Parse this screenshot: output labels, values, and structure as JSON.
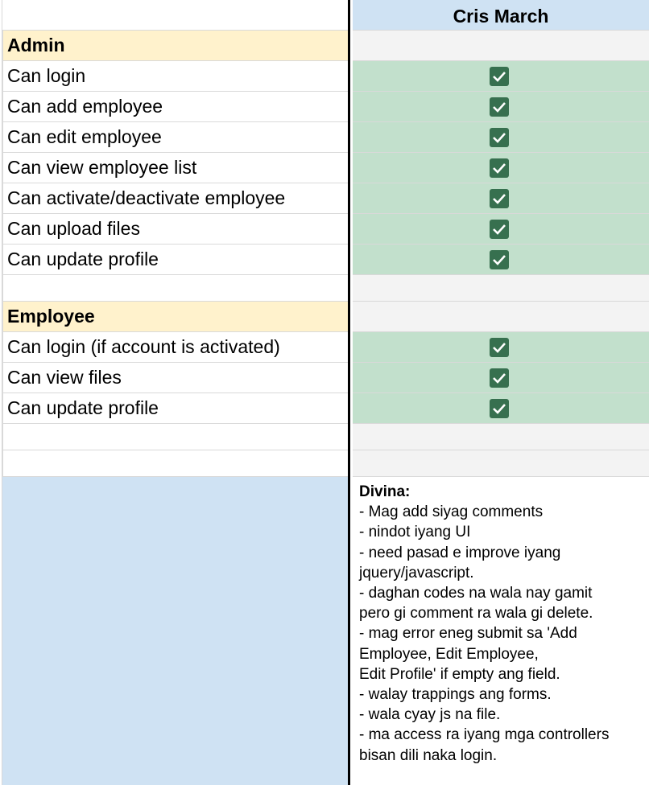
{
  "header": {
    "column_name": "Cris March"
  },
  "sections": [
    {
      "title": "Admin",
      "items": [
        {
          "label": "Can login",
          "checked": true
        },
        {
          "label": "Can add employee",
          "checked": true
        },
        {
          "label": "Can edit employee",
          "checked": true
        },
        {
          "label": "Can view employee list",
          "checked": true
        },
        {
          "label": "Can activate/deactivate employee",
          "checked": true
        },
        {
          "label": "Can upload files",
          "checked": true
        },
        {
          "label": "Can update profile",
          "checked": true
        }
      ]
    },
    {
      "title": "Employee",
      "items": [
        {
          "label": "Can login (if account is activated)",
          "checked": true
        },
        {
          "label": "Can view files",
          "checked": true
        },
        {
          "label": "Can update profile",
          "checked": true
        }
      ]
    }
  ],
  "notes": {
    "author": "Divina:",
    "lines": [
      "- Mag add siyag comments",
      "- nindot iyang UI",
      "- need pasad e improve iyang",
      "jquery/javascript.",
      "- daghan codes na wala nay gamit",
      "pero gi comment ra wala gi delete.",
      "- mag error eneg submit sa 'Add",
      "Employee, Edit Employee,",
      "Edit Profile' if empty ang field.",
      "- walay trappings ang forms.",
      "- wala cyay js na file.",
      "- ma access ra iyang mga controllers",
      "bisan dili naka login."
    ]
  },
  "colors": {
    "section_bg": "#fff2cc",
    "check_cell_bg": "#c2e0cc",
    "check_box": "#37704f",
    "header_bg": "#cfe2f3",
    "empty_cell_bg": "#f3f3f3"
  }
}
